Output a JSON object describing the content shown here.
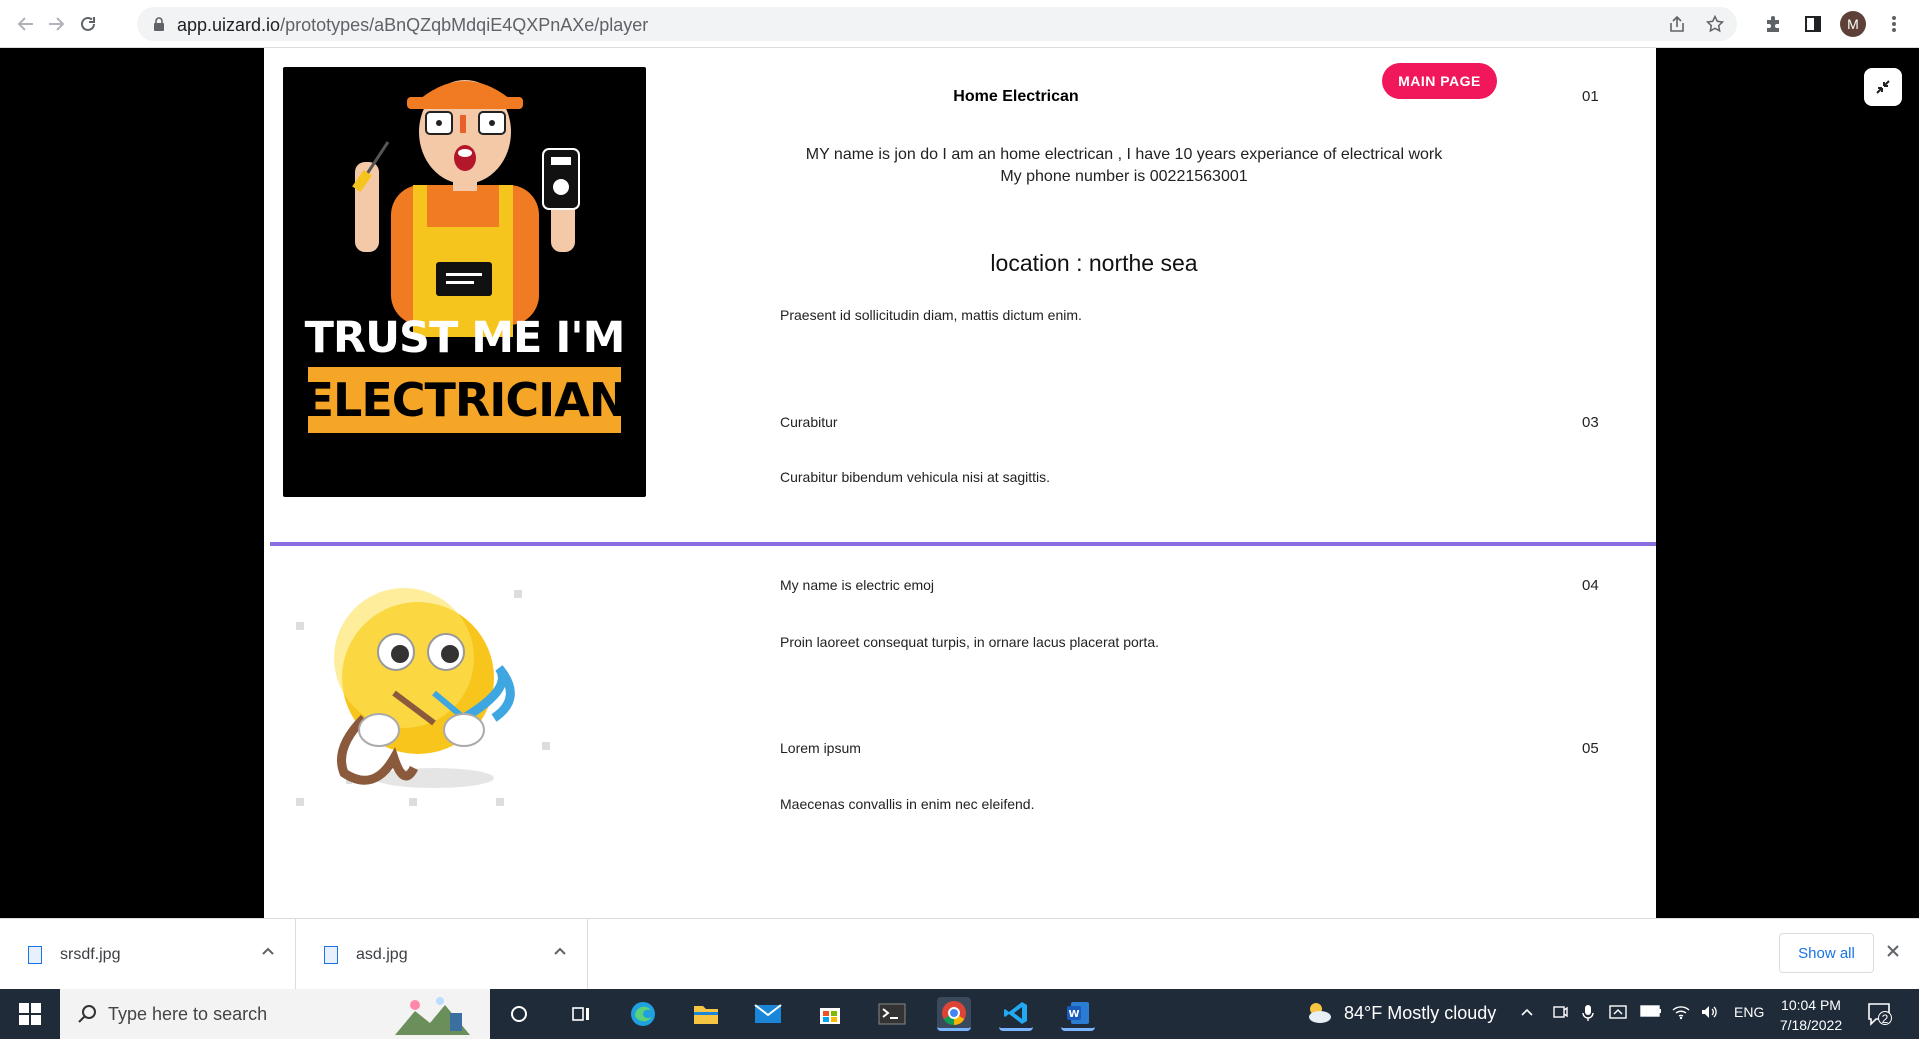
{
  "browser": {
    "url_host": "app.uizard.io",
    "url_path": "/prototypes/aBnQZqbMdqiE4QXPnAXe/player",
    "avatar_letter": "M"
  },
  "page": {
    "main_page_button": "MAIN PAGE",
    "section1": {
      "title": "Home Electrican",
      "number": "01",
      "bio_line1": "MY name is jon do I am an home electrican , I have 10 years experiance of electrical work",
      "bio_line2": "My phone number is 00221563001",
      "location": "location  : northe sea",
      "description": "Praesent id sollicitudin diam, mattis dictum enim.",
      "item_title": "Curabitur",
      "item_number": "03",
      "item_text": "Curabitur bibendum vehicula nisi at sagittis."
    },
    "image1": {
      "line1": "TRUST ME I'M A",
      "line2": "ELECTRICIAN"
    },
    "section2": {
      "title": "My name is electric emoj",
      "number": "04",
      "description": "Proin laoreet consequat turpis, in ornare lacus placerat porta.",
      "item_title": "Lorem ipsum",
      "item_number": "05",
      "item_text": "Maecenas convallis in enim nec eleifend."
    }
  },
  "downloads": {
    "items": [
      {
        "name": "srsdf.jpg"
      },
      {
        "name": "asd.jpg"
      }
    ],
    "show_all": "Show all"
  },
  "taskbar": {
    "search_placeholder": "Type here to search",
    "weather": "84°F  Mostly cloudy",
    "language": "ENG",
    "time": "10:04 PM",
    "date": "7/18/2022",
    "notification_count": "2"
  },
  "colors": {
    "accent_button": "#f0185b",
    "divider": "#8a6fe0",
    "electrician_box": "#f6a627"
  }
}
